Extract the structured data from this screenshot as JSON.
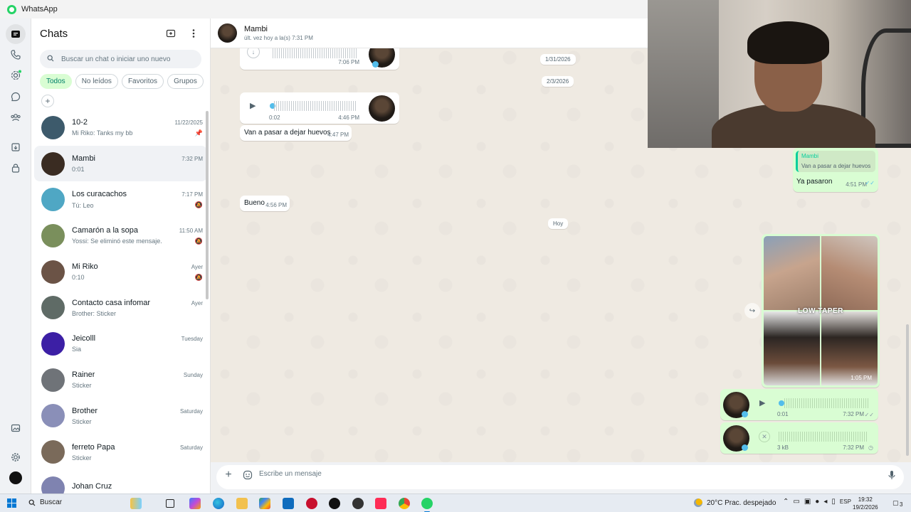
{
  "window": {
    "title": "WhatsApp"
  },
  "rail": {
    "icons": [
      "chats-icon",
      "calls-icon",
      "status-icon",
      "channels-icon",
      "communities-icon",
      "archived-icon",
      "lock-icon",
      "media-icon",
      "settings-icon",
      "profile-avatar"
    ]
  },
  "chatlist": {
    "title": "Chats",
    "search_placeholder": "Buscar un chat o iniciar uno nuevo",
    "filters": [
      "Todos",
      "No leídos",
      "Favoritos",
      "Grupos"
    ],
    "active_filter": "Todos",
    "chats": [
      {
        "name": "10-2",
        "time": "11/22/2025",
        "preview": "Mi Riko: Tanks my bb",
        "flag": "pin-icon",
        "avatar_color": "#3d5a6b"
      },
      {
        "name": "Mambi",
        "time": "7:32 PM",
        "preview": "0:01",
        "flag": "",
        "avatar_color": "#3a2c22",
        "selected": true
      },
      {
        "name": "Los curacachos",
        "time": "7:17 PM",
        "preview": "Tú: Leo",
        "flag": "muted-icon",
        "avatar_color": "#4fa7c4"
      },
      {
        "name": "Camarón a la sopa",
        "time": "11:50 AM",
        "preview": "Yossi: Se eliminó este mensaje.",
        "flag": "muted-icon",
        "avatar_color": "#7a8f5c"
      },
      {
        "name": "Mi Riko",
        "time": "Ayer",
        "preview": "0:10",
        "flag": "muted-icon",
        "avatar_color": "#6b5346"
      },
      {
        "name": "Contacto casa infomar",
        "time": "Ayer",
        "preview": "Brother: Sticker",
        "flag": "",
        "avatar_color": "#5f6b66"
      },
      {
        "name": "Jeicolll",
        "time": "Tuesday",
        "preview": "Sia",
        "flag": "",
        "avatar_color": "#3c1fa5"
      },
      {
        "name": "Rainer",
        "time": "Sunday",
        "preview": "Sticker",
        "flag": "",
        "avatar_color": "#6f7378"
      },
      {
        "name": "Brother",
        "time": "Saturday",
        "preview": "Sticker",
        "flag": "",
        "avatar_color": "#8a8fb8"
      },
      {
        "name": "ferreto Papa",
        "time": "Saturday",
        "preview": "Sticker",
        "flag": "",
        "avatar_color": "#7a6a5a"
      },
      {
        "name": "Johan Cruz",
        "time": "",
        "preview": "",
        "flag": "",
        "avatar_color": "#7f83b0"
      }
    ]
  },
  "conversation": {
    "name": "Mambi",
    "status": "últ. vez hoy a la(s) 7:31 PM",
    "messages": {
      "voice1_time": "7:06 PM",
      "date1": "1/31/2026",
      "date2": "2/3/2026",
      "voice2_duration": "0:02",
      "voice2_time": "4:46 PM",
      "text1": "Van a pasar a dejar huevos",
      "text1_time": "4:47 PM",
      "reply_quote_name": "Mambi",
      "reply_quote_text": "Van a pasar a dejar huevos",
      "reply_text": "Ya pasaron",
      "reply_time": "4:51 PM",
      "text2": "Bueno",
      "text2_time": "4:56 PM",
      "date3": "Hoy",
      "image_caption": "LOW TAPER",
      "image_time": "1:05 PM",
      "voice3_duration": "0:01",
      "voice3_time": "7:32 PM",
      "voice4_size": "3 kB",
      "voice4_time": "7:32 PM"
    },
    "composer_placeholder": "Escribe un mensaje"
  },
  "taskbar": {
    "search_label": "Buscar",
    "weather": "20°C  Prac. despejado",
    "lang": "ESP",
    "time": "19:32",
    "date": "19/2/2026",
    "notif_count": "3"
  },
  "colors": {
    "accent": "#25d366",
    "chip_active_bg": "#d9fdd3",
    "outgoing_bubble": "#d9fdd3",
    "wallpaper": "#efeae2",
    "voice_dot": "#53bdeb"
  }
}
